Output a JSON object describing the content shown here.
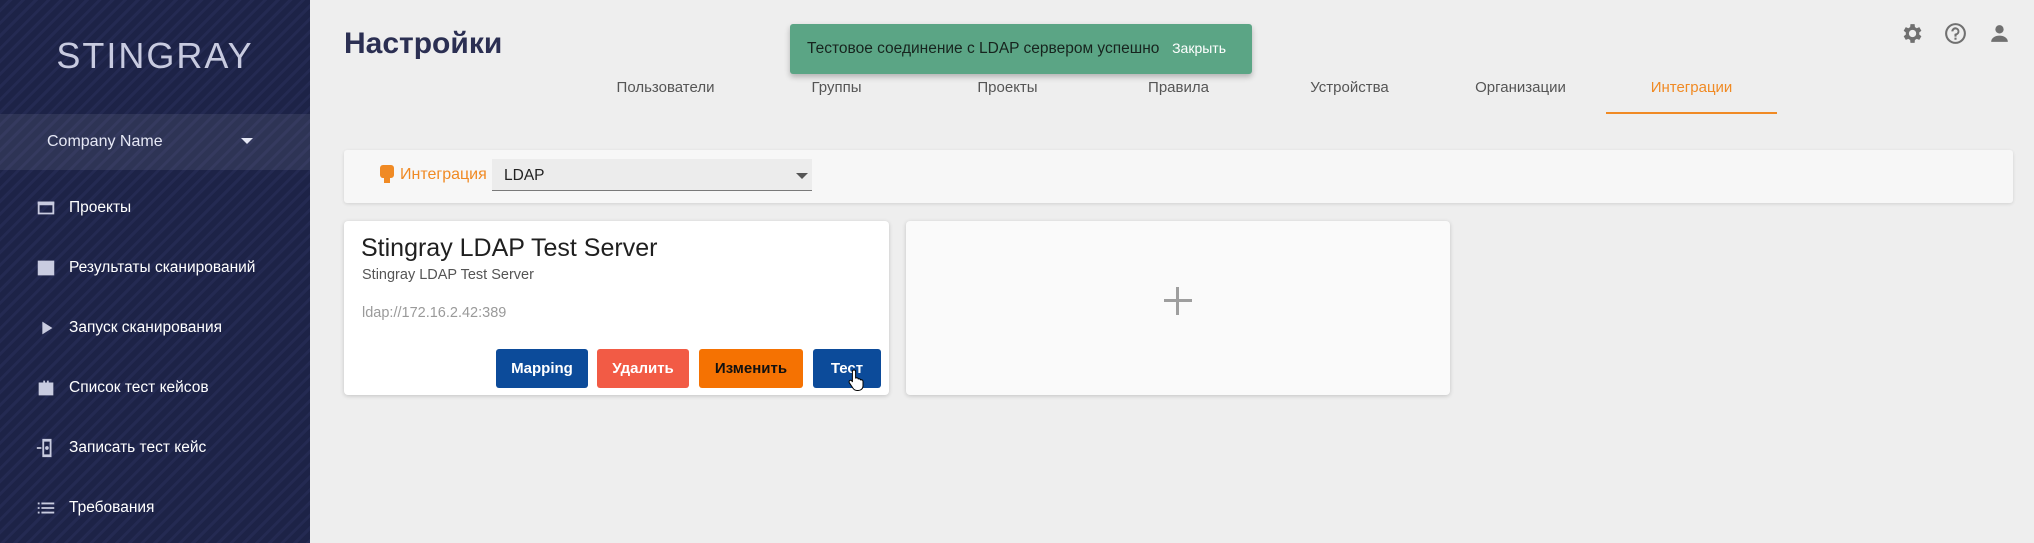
{
  "brand": "STINGRAY",
  "company": {
    "name": "Company Name"
  },
  "sidebar": {
    "items": [
      {
        "label": "Проекты",
        "icon": "projects-icon"
      },
      {
        "label": "Результаты сканирований",
        "icon": "scan-results-icon"
      },
      {
        "label": "Запуск сканирования",
        "icon": "play-icon"
      },
      {
        "label": "Список тест кейсов",
        "icon": "briefcase-icon"
      },
      {
        "label": "Записать тест кейс",
        "icon": "record-device-icon"
      },
      {
        "label": "Требования",
        "icon": "list-icon"
      }
    ]
  },
  "header": {
    "title": "Настройки",
    "icons": [
      "gear-icon",
      "help-icon",
      "account-icon"
    ]
  },
  "tabs": [
    {
      "label": "Пользователи"
    },
    {
      "label": "Группы"
    },
    {
      "label": "Проекты"
    },
    {
      "label": "Правила"
    },
    {
      "label": "Устройства"
    },
    {
      "label": "Организации"
    },
    {
      "label": "Интеграции",
      "active": true
    }
  ],
  "toast": {
    "message": "Тестовое соединение с LDAP сервером успешно",
    "close_label": "Закрыть"
  },
  "integration": {
    "label": "Интеграция",
    "selected": "LDAP"
  },
  "server_card": {
    "title": "Stingray LDAP Test Server",
    "subtitle": "Stingray LDAP Test Server",
    "url": "ldap://172.16.2.42:389",
    "buttons": {
      "mapping": "Mapping",
      "delete": "Удалить",
      "edit": "Изменить",
      "test": "Тест"
    }
  },
  "colors": {
    "sidebar_bg": "#1d2347",
    "accent": "#f08a24",
    "toast_bg": "#5ba585",
    "primary_btn": "#0c4b9a",
    "delete_btn": "#f25b45",
    "edit_btn": "#f57202"
  }
}
